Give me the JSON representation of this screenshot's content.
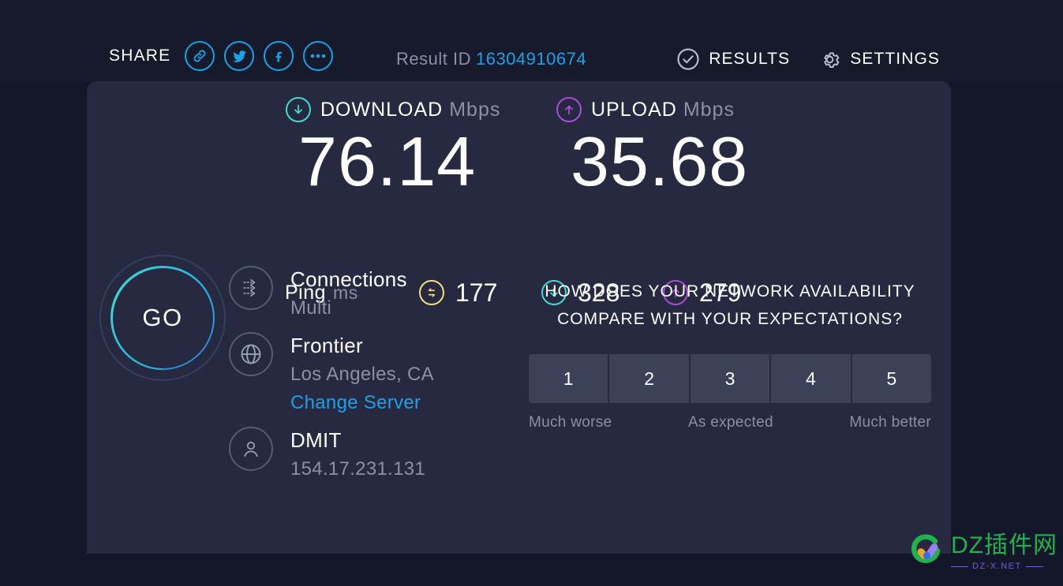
{
  "header": {
    "share_label": "SHARE",
    "share_icons": [
      {
        "name": "link-icon"
      },
      {
        "name": "twitter-icon"
      },
      {
        "name": "facebook-icon"
      },
      {
        "name": "more-options-icon"
      }
    ],
    "result_id_label": "Result ID",
    "result_id_value": "16304910674",
    "results_label": "RESULTS",
    "settings_label": "SETTINGS"
  },
  "speeds": {
    "download": {
      "title": "DOWNLOAD",
      "unit": "Mbps",
      "value": "76.14",
      "color": "#3cded0"
    },
    "upload": {
      "title": "UPLOAD",
      "unit": "Mbps",
      "value": "35.68",
      "color": "#a94fd6"
    }
  },
  "ping": {
    "label": "Ping",
    "unit": "ms",
    "idle": {
      "value": "177",
      "color": "#f4e07a",
      "icon": "ping-idle-icon"
    },
    "download": {
      "value": "328",
      "color": "#3cded0",
      "icon": "ping-download-icon"
    },
    "upload": {
      "value": "279",
      "color": "#a94fd6",
      "icon": "ping-upload-icon"
    }
  },
  "go_button": {
    "label": "GO"
  },
  "connection_info": [
    {
      "icon": "multi-connections-icon",
      "title": "Connections",
      "sub": "Multi"
    },
    {
      "icon": "globe-icon",
      "title": "Frontier",
      "sub": "Los Angeles, CA",
      "link": "Change Server"
    },
    {
      "icon": "user-icon",
      "title": "DMIT",
      "sub": "154.17.231.131"
    }
  ],
  "survey": {
    "question": "HOW DOES YOUR NETWORK AVAILABILITY COMPARE WITH YOUR EXPECTATIONS?",
    "ratings": [
      "1",
      "2",
      "3",
      "4",
      "5"
    ],
    "scale_low": "Much worse",
    "scale_mid": "As expected",
    "scale_high": "Much better"
  },
  "watermark": {
    "main": "DZ插件网",
    "sub": "DZ-X.NET"
  },
  "colors": {
    "page_bg": "#14162a",
    "header_bg": "#171a2b",
    "panel_bg": "#262940",
    "accent_blue": "#1ba1e8",
    "muted_text": "#8b90a8"
  }
}
